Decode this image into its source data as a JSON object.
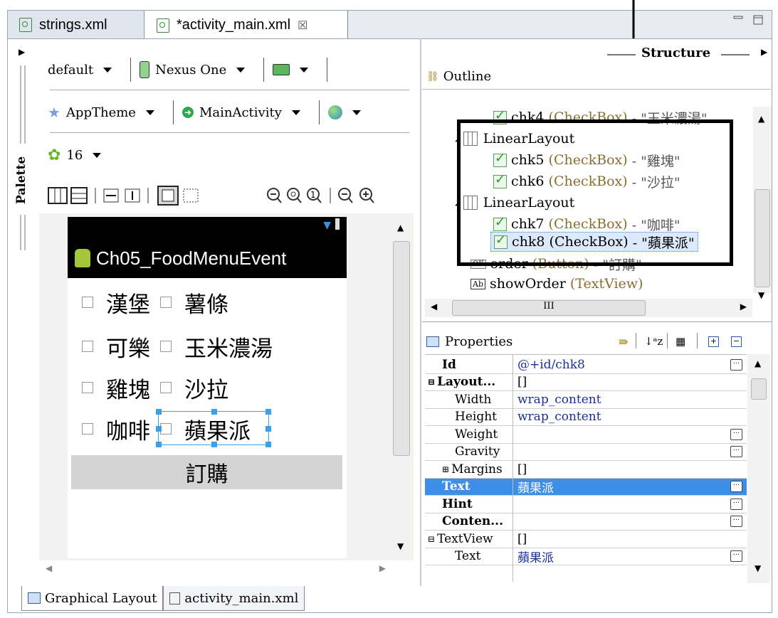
{
  "tabs": [
    {
      "label": "strings.xml"
    },
    {
      "label": "*activity_main.xml",
      "close": "☒"
    }
  ],
  "palette": {
    "label": "Palette"
  },
  "toolbar": {
    "config": "default",
    "device": "Nexus One",
    "theme": "AppTheme",
    "activity": "MainActivity",
    "api": "16"
  },
  "phone": {
    "app_title": "Ch05_FoodMenuEvent",
    "rows": [
      [
        "漢堡",
        "薯條"
      ],
      [
        "可樂",
        "玉米濃湯"
      ],
      [
        "雞塊",
        "沙拉"
      ],
      [
        "咖啡",
        "蘋果派"
      ]
    ],
    "order_button": "訂購"
  },
  "bottom_tabs": [
    "Graphical Layout",
    "activity_main.xml"
  ],
  "structure": {
    "header": "Structure",
    "outline_label": "Outline",
    "items": [
      {
        "name": "chk4",
        "type": "(CheckBox)",
        "text": "- \"玉米濃湯\""
      },
      {
        "name": "LinearLayout"
      },
      {
        "name": "chk5",
        "type": "(CheckBox)",
        "text": "- \"雞塊\""
      },
      {
        "name": "chk6",
        "type": "(CheckBox)",
        "text": "- \"沙拉\""
      },
      {
        "name": "LinearLayout"
      },
      {
        "name": "chk7",
        "type": "(CheckBox)",
        "text": "- \"咖啡\""
      },
      {
        "name": "chk8",
        "type": "(CheckBox)",
        "text": "- \"蘋果派\""
      },
      {
        "name": "order",
        "type": "(Button)",
        "text": "- \"訂購\""
      },
      {
        "name": "showOrder",
        "type": "(TextView)",
        "text": ""
      }
    ],
    "hscroll_glyph": "III"
  },
  "properties": {
    "header": "Properties",
    "rows": [
      {
        "name": "Id",
        "value": "@+id/chk8"
      },
      {
        "name": "Layout...",
        "value": "[]"
      },
      {
        "name": "Width",
        "value": "wrap_content"
      },
      {
        "name": "Height",
        "value": "wrap_content"
      },
      {
        "name": "Weight",
        "value": ""
      },
      {
        "name": "Gravity",
        "value": ""
      },
      {
        "name": "Margins",
        "value": "[]"
      },
      {
        "name": "Text",
        "value": "蘋果派"
      },
      {
        "name": "Hint",
        "value": ""
      },
      {
        "name": "Conten...",
        "value": ""
      },
      {
        "name": "TextView",
        "value": "[]"
      },
      {
        "name": "Text",
        "value": "蘋果派"
      }
    ]
  },
  "colors": {
    "selection": "#3d8ee8",
    "accent_arrow": "#000000"
  }
}
